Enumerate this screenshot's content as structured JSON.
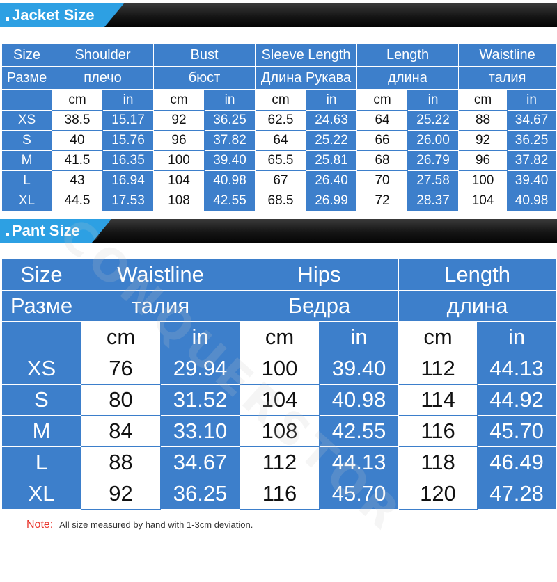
{
  "jacket": {
    "banner_title": "Jacket Size",
    "header_en": [
      "Size",
      "Shoulder",
      "Bust",
      "Sleeve Length",
      "Length",
      "Waistline"
    ],
    "header_ru": [
      "Разме",
      "плечо",
      "бюст",
      "Длина Рукава",
      "длина",
      "талия"
    ],
    "units": [
      "cm",
      "in",
      "cm",
      "in",
      "cm",
      "in",
      "cm",
      "in",
      "cm",
      "in"
    ],
    "rows": [
      {
        "size": "XS",
        "values": [
          "38.5",
          "15.17",
          "92",
          "36.25",
          "62.5",
          "24.63",
          "64",
          "25.22",
          "88",
          "34.67"
        ]
      },
      {
        "size": "S",
        "values": [
          "40",
          "15.76",
          "96",
          "37.82",
          "64",
          "25.22",
          "66",
          "26.00",
          "92",
          "36.25"
        ]
      },
      {
        "size": "M",
        "values": [
          "41.5",
          "16.35",
          "100",
          "39.40",
          "65.5",
          "25.81",
          "68",
          "26.79",
          "96",
          "37.82"
        ]
      },
      {
        "size": "L",
        "values": [
          "43",
          "16.94",
          "104",
          "40.98",
          "67",
          "26.40",
          "70",
          "27.58",
          "100",
          "39.40"
        ]
      },
      {
        "size": "XL",
        "values": [
          "44.5",
          "17.53",
          "108",
          "42.55",
          "68.5",
          "26.99",
          "72",
          "28.37",
          "104",
          "40.98"
        ]
      }
    ]
  },
  "pant": {
    "banner_title": "Pant Size",
    "header_en": [
      "Size",
      "Waistline",
      "Hips",
      "Length"
    ],
    "header_ru": [
      "Разме",
      "талия",
      "Бедра",
      "длина"
    ],
    "units": [
      "cm",
      "in",
      "cm",
      "in",
      "cm",
      "in"
    ],
    "rows": [
      {
        "size": "XS",
        "values": [
          "76",
          "29.94",
          "100",
          "39.40",
          "112",
          "44.13"
        ]
      },
      {
        "size": "S",
        "values": [
          "80",
          "31.52",
          "104",
          "40.98",
          "114",
          "44.92"
        ]
      },
      {
        "size": "M",
        "values": [
          "84",
          "33.10",
          "108",
          "42.55",
          "116",
          "45.70"
        ]
      },
      {
        "size": "L",
        "values": [
          "88",
          "34.67",
          "112",
          "44.13",
          "118",
          "46.49"
        ]
      },
      {
        "size": "XL",
        "values": [
          "92",
          "36.25",
          "116",
          "45.70",
          "120",
          "47.28"
        ]
      }
    ]
  },
  "note": {
    "label": "Note:",
    "text": "All size measured by hand with 1-3cm deviation."
  },
  "watermark": "CONQUERSTOR",
  "colors": {
    "table_blue": "#3d7fcb",
    "banner_blue": "#2da0e3",
    "note_red": "#e8332a"
  }
}
